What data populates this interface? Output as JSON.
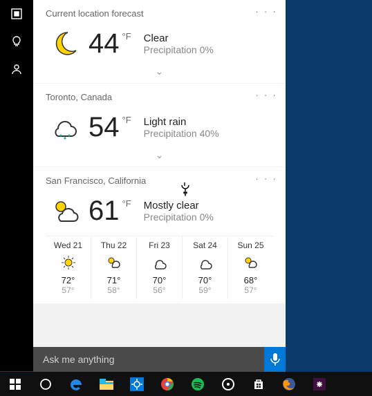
{
  "sidebar": {
    "icons": [
      "square",
      "bulb",
      "person"
    ]
  },
  "cards": [
    {
      "location": "Current location forecast",
      "temp": "44",
      "unit": "°F",
      "cond": "Clear",
      "precip": "Precipitation 0%",
      "icon": "moon"
    },
    {
      "location": "Toronto, Canada",
      "temp": "54",
      "unit": "°F",
      "cond": "Light rain",
      "precip": "Precipitation 40%",
      "icon": "rain"
    },
    {
      "location": "San Francisco, California",
      "temp": "61",
      "unit": "°F",
      "cond": "Mostly clear",
      "precip": "Precipitation 0%",
      "icon": "sun-cloud",
      "forecast": [
        {
          "label": "Wed 21",
          "icon": "sun",
          "hi": "72°",
          "lo": "57°"
        },
        {
          "label": "Thu 22",
          "icon": "sun-cloud",
          "hi": "71°",
          "lo": "58°"
        },
        {
          "label": "Fri 23",
          "icon": "cloud",
          "hi": "70°",
          "lo": "56°"
        },
        {
          "label": "Sat 24",
          "icon": "cloud",
          "hi": "70°",
          "lo": "59°"
        },
        {
          "label": "Sun 25",
          "icon": "sun-cloud",
          "hi": "68°",
          "lo": "57°"
        }
      ]
    }
  ],
  "search": {
    "placeholder": "Ask me anything"
  },
  "more_glyph": "· · ·",
  "taskbar": {
    "items": [
      "start",
      "cortana",
      "edge",
      "explorer",
      "settings",
      "chrome",
      "spotify",
      "discord",
      "store",
      "firefox",
      "slack"
    ]
  }
}
